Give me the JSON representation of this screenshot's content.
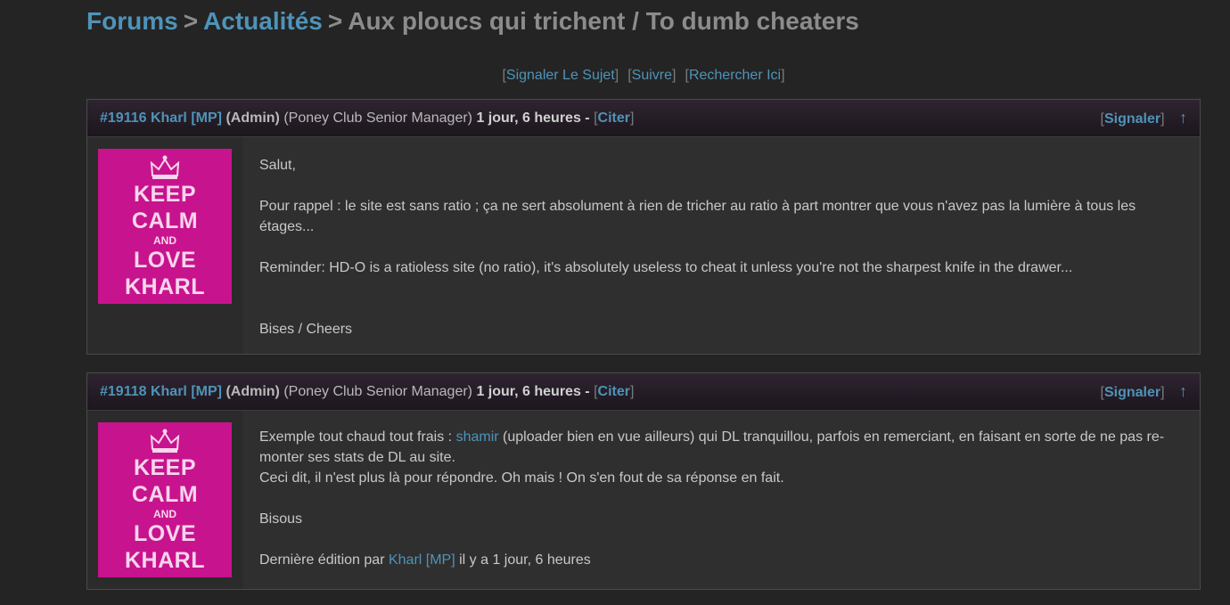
{
  "breadcrumb": {
    "forums": "Forums",
    "sep1": ">",
    "category": "Actualités",
    "sep2": ">",
    "topic": "Aux ploucs qui trichent / To dumb cheaters"
  },
  "actions": {
    "report_topic": "Signaler Le Sujet",
    "follow": "Suivre",
    "search_here": "Rechercher Ici"
  },
  "avatar": {
    "line1": "KEEP",
    "line2": "CALM",
    "line3": "AND",
    "line4": "LOVE",
    "line5": "KHARL"
  },
  "posts": [
    {
      "id": "#19116",
      "author": "Kharl",
      "pm": "[MP]",
      "role": "(Admin)",
      "title": "(Poney Club Senior Manager)",
      "time": "1 jour, 6 heures -",
      "quote": "Citer",
      "report": "Signaler",
      "up": "↑",
      "paragraphs": [
        "Salut,",
        "",
        "Pour rappel : le site est sans ratio ; ça ne sert absolument à rien de tricher au ratio à part montrer que vous n'avez pas la lumière à tous les étages...",
        "",
        "Reminder: HD-O is a ratioless site (no ratio), it's absolutely useless to cheat it unless you're not the sharpest knife in the drawer...",
        "",
        "",
        "Bises / Cheers"
      ]
    },
    {
      "id": "#19118",
      "author": "Kharl",
      "pm": "[MP]",
      "role": "(Admin)",
      "title": "(Poney Club Senior Manager)",
      "time": "1 jour, 6 heures -",
      "quote": "Citer",
      "report": "Signaler",
      "up": "↑",
      "p1_before": "Exemple tout chaud tout frais : ",
      "p1_link": "shamir",
      "p1_after": " (uploader bien en vue ailleurs) qui DL tranquillou, parfois en remerciant, en faisant en sorte de ne pas re-monter ses stats de DL au site.",
      "p2": "Ceci dit, il n'est plus là pour répondre. Oh mais ! On s'en fout de sa réponse en fait.",
      "p3": "Bisous",
      "edit_before": "Dernière édition par ",
      "edit_link": "Kharl [MP]",
      "edit_after": " il y a 1 jour, 6 heures"
    }
  ]
}
